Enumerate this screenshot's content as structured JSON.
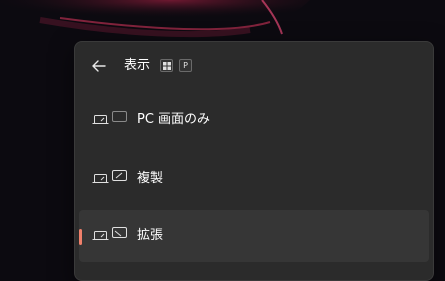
{
  "panel": {
    "title": "表示",
    "shortcut_keys": [
      "P"
    ]
  },
  "options": [
    {
      "label": "PC 画面のみ",
      "icon": "pc-screen-only-icon",
      "selected": false
    },
    {
      "label": "複製",
      "icon": "duplicate-icon",
      "selected": false
    },
    {
      "label": "拡張",
      "icon": "extend-icon",
      "selected": true
    }
  ],
  "colors": {
    "panel_bg": "#2b2b2b",
    "selected_bg": "#363636",
    "accent": "#f0806b"
  }
}
